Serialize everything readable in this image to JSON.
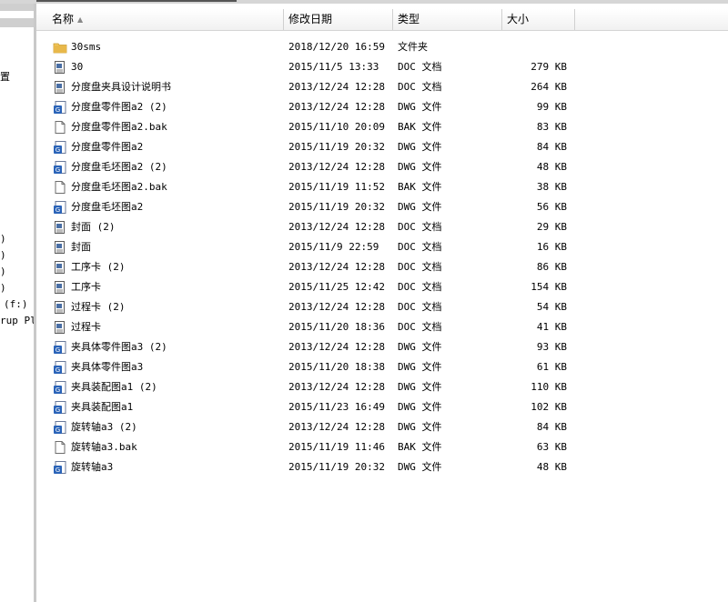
{
  "window": {},
  "nav": {
    "items": [
      "置",
      ")",
      ")",
      ")",
      ")",
      "(f:)",
      "rup Plu"
    ]
  },
  "columns": {
    "name": "名称",
    "date": "修改日期",
    "type": "类型",
    "size": "大小"
  },
  "files": [
    {
      "name": "30sms",
      "date": "2018/12/20 16:59",
      "type": "文件夹",
      "size": "",
      "icon": "folder-icon"
    },
    {
      "name": "30",
      "date": "2015/11/5 13:33",
      "type": "DOC 文档",
      "size": "279 KB",
      "icon": "doc-icon"
    },
    {
      "name": "分度盘夹具设计说明书",
      "date": "2013/12/24 12:28",
      "type": "DOC 文档",
      "size": "264 KB",
      "icon": "doc-icon"
    },
    {
      "name": "分度盘零件图a2 (2)",
      "date": "2013/12/24 12:28",
      "type": "DWG 文件",
      "size": "99 KB",
      "icon": "dwg-icon"
    },
    {
      "name": "分度盘零件图a2.bak",
      "date": "2015/11/10 20:09",
      "type": "BAK 文件",
      "size": "83 KB",
      "icon": "file-icon"
    },
    {
      "name": "分度盘零件图a2",
      "date": "2015/11/19 20:32",
      "type": "DWG 文件",
      "size": "84 KB",
      "icon": "dwg-icon"
    },
    {
      "name": "分度盘毛坯图a2 (2)",
      "date": "2013/12/24 12:28",
      "type": "DWG 文件",
      "size": "48 KB",
      "icon": "dwg-icon"
    },
    {
      "name": "分度盘毛坯图a2.bak",
      "date": "2015/11/19 11:52",
      "type": "BAK 文件",
      "size": "38 KB",
      "icon": "file-icon"
    },
    {
      "name": "分度盘毛坯图a2",
      "date": "2015/11/19 20:32",
      "type": "DWG 文件",
      "size": "56 KB",
      "icon": "dwg-icon"
    },
    {
      "name": "封面 (2)",
      "date": "2013/12/24 12:28",
      "type": "DOC 文档",
      "size": "29 KB",
      "icon": "doc-icon"
    },
    {
      "name": "封面",
      "date": "2015/11/9 22:59",
      "type": "DOC 文档",
      "size": "16 KB",
      "icon": "doc-icon"
    },
    {
      "name": "工序卡 (2)",
      "date": "2013/12/24 12:28",
      "type": "DOC 文档",
      "size": "86 KB",
      "icon": "doc-icon"
    },
    {
      "name": "工序卡",
      "date": "2015/11/25 12:42",
      "type": "DOC 文档",
      "size": "154 KB",
      "icon": "doc-icon"
    },
    {
      "name": "过程卡 (2)",
      "date": "2013/12/24 12:28",
      "type": "DOC 文档",
      "size": "54 KB",
      "icon": "doc-icon"
    },
    {
      "name": "过程卡",
      "date": "2015/11/20 18:36",
      "type": "DOC 文档",
      "size": "41 KB",
      "icon": "doc-icon"
    },
    {
      "name": "夹具体零件图a3 (2)",
      "date": "2013/12/24 12:28",
      "type": "DWG 文件",
      "size": "93 KB",
      "icon": "dwg-icon"
    },
    {
      "name": "夹具体零件图a3",
      "date": "2015/11/20 18:38",
      "type": "DWG 文件",
      "size": "61 KB",
      "icon": "dwg-icon"
    },
    {
      "name": "夹具装配图a1 (2)",
      "date": "2013/12/24 12:28",
      "type": "DWG 文件",
      "size": "110 KB",
      "icon": "dwg-icon"
    },
    {
      "name": "夹具装配图a1",
      "date": "2015/11/23 16:49",
      "type": "DWG 文件",
      "size": "102 KB",
      "icon": "dwg-icon"
    },
    {
      "name": "旋转轴a3 (2)",
      "date": "2013/12/24 12:28",
      "type": "DWG 文件",
      "size": "84 KB",
      "icon": "dwg-icon"
    },
    {
      "name": "旋转轴a3.bak",
      "date": "2015/11/19 11:46",
      "type": "BAK 文件",
      "size": "63 KB",
      "icon": "file-icon"
    },
    {
      "name": "旋转轴a3",
      "date": "2015/11/19 20:32",
      "type": "DWG 文件",
      "size": "48 KB",
      "icon": "dwg-icon"
    }
  ],
  "colors": {
    "folder": "#e8b84a",
    "dwg": "#2a63b8",
    "doc": "#4a6fa5"
  }
}
